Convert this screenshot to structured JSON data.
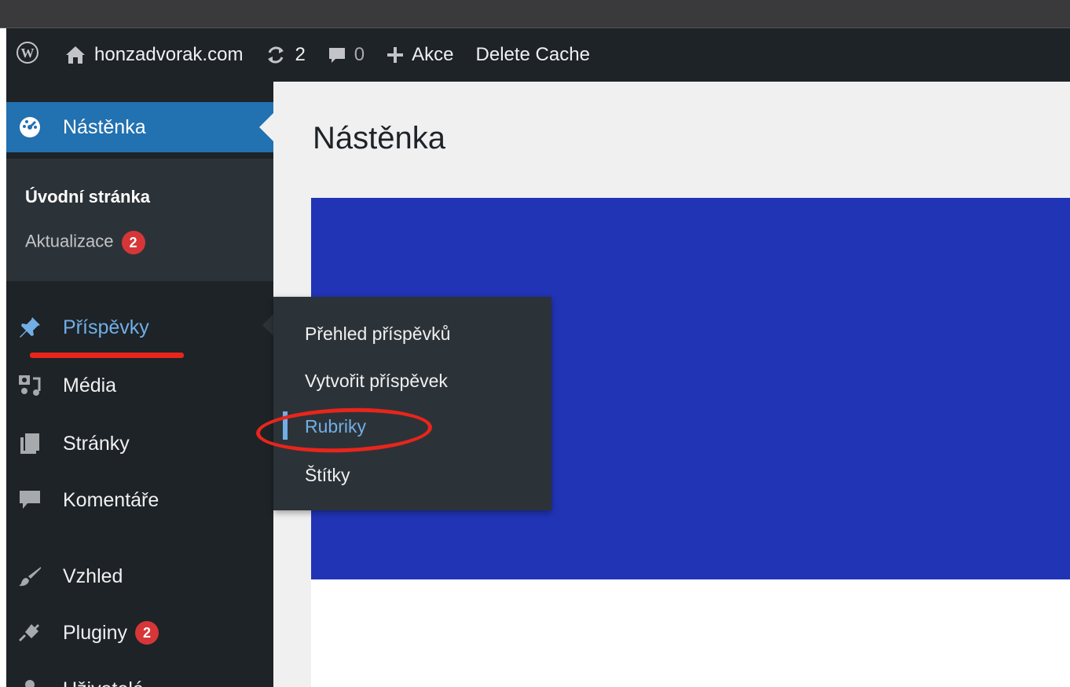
{
  "admin_bar": {
    "site_name": "honzadvorak.com",
    "updates_count": "2",
    "comments_count": "0",
    "new_label": "Akce",
    "cache_label": "Delete Cache"
  },
  "sidebar": {
    "dashboard_label": "Nástěnka",
    "dashboard_sub": [
      {
        "label": "Úvodní stránka"
      },
      {
        "label": "Aktualizace",
        "badge": "2"
      }
    ],
    "items": [
      {
        "label": "Příspěvky",
        "icon": "pin-icon"
      },
      {
        "label": "Média",
        "icon": "media-icon"
      },
      {
        "label": "Stránky",
        "icon": "pages-icon"
      },
      {
        "label": "Komentáře",
        "icon": "comments-icon"
      },
      {
        "label": "Vzhled",
        "icon": "brush-icon"
      },
      {
        "label": "Pluginy",
        "icon": "plugin-icon",
        "badge": "2"
      },
      {
        "label": "Uživatelé",
        "icon": "users-icon"
      }
    ]
  },
  "flyout": {
    "items": [
      {
        "label": "Přehled příspěvků"
      },
      {
        "label": "Vytvořit příspěvek"
      },
      {
        "label": "Rubriky"
      },
      {
        "label": "Štítky"
      }
    ]
  },
  "main": {
    "title": "Nástěnka"
  },
  "colors": {
    "admin_bar_bg": "#1d2327",
    "current_item_bg": "#2271b1",
    "link_hover": "#72aee6",
    "badge": "#d63638",
    "annotation": "#e8251c",
    "panel_blue": "#2134b6"
  }
}
